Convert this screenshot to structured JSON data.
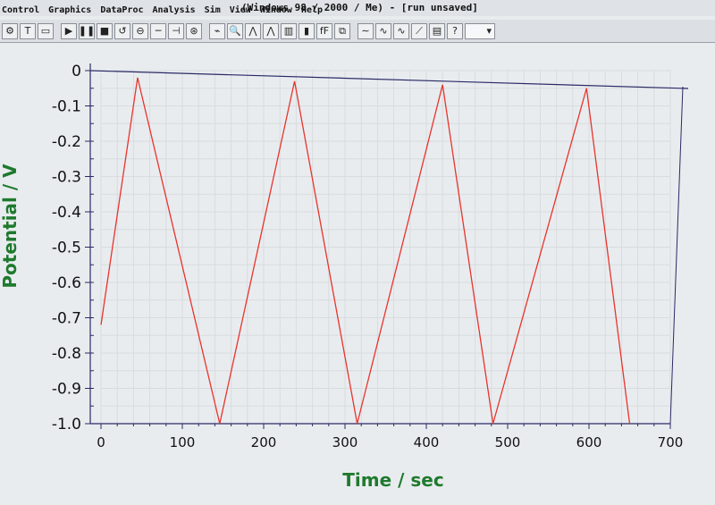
{
  "window": {
    "title": "(Windows 98 / 2000 / Me) - [run unsaved]"
  },
  "menu": [
    "Control",
    "Graphics",
    "DataProc",
    "Analysis",
    "Sim",
    "View",
    "Window",
    "Help"
  ],
  "toolbar": {
    "buttons": [
      {
        "name": "setup-icon",
        "glyph": "⚙"
      },
      {
        "name": "text-icon",
        "glyph": "T"
      },
      {
        "name": "window-icon",
        "glyph": "▭"
      },
      {
        "name": "sep"
      },
      {
        "name": "run-icon",
        "glyph": "▶"
      },
      {
        "name": "pause-icon",
        "glyph": "❚❚"
      },
      {
        "name": "stop-icon",
        "glyph": "■"
      },
      {
        "name": "reverse-icon",
        "glyph": "↺"
      },
      {
        "name": "zero-icon",
        "glyph": "⊖"
      },
      {
        "name": "filter-icon",
        "glyph": "─"
      },
      {
        "name": "cell-icon",
        "glyph": "⊣"
      },
      {
        "name": "rotate-icon",
        "glyph": "⊛"
      },
      {
        "name": "sep"
      },
      {
        "name": "graph-icon",
        "glyph": "⌁"
      },
      {
        "name": "zoom-icon",
        "glyph": "🔍"
      },
      {
        "name": "peak-icon",
        "glyph": "⋀"
      },
      {
        "name": "peak2-icon",
        "glyph": "⋀"
      },
      {
        "name": "color-icon",
        "glyph": "▥"
      },
      {
        "name": "bars-icon",
        "glyph": "▮"
      },
      {
        "name": "font-icon",
        "glyph": "fF"
      },
      {
        "name": "copy-icon",
        "glyph": "⧉"
      },
      {
        "name": "sep"
      },
      {
        "name": "wave1-icon",
        "glyph": "∼"
      },
      {
        "name": "wave2-icon",
        "glyph": "∿"
      },
      {
        "name": "wave3-icon",
        "glyph": "∿"
      },
      {
        "name": "wave4-icon",
        "glyph": "⟋"
      },
      {
        "name": "table-icon",
        "glyph": "▤"
      },
      {
        "name": "help-icon",
        "glyph": "?"
      }
    ],
    "combo_arrow": "▾"
  },
  "chart_data": {
    "type": "line",
    "xlabel": "Time / sec",
    "ylabel": "Potential / V",
    "xlim": [
      0,
      700
    ],
    "ylim": [
      -1.0,
      0
    ],
    "xticks": [
      "0",
      "100",
      "200",
      "300",
      "400",
      "500",
      "600",
      "700"
    ],
    "yticks": [
      "0",
      "-0.1",
      "-0.2",
      "-0.3",
      "-0.4",
      "-0.5",
      "-0.6",
      "-0.7",
      "-0.8",
      "-0.9",
      "-1.0"
    ],
    "series": [
      {
        "color": "#e8342c",
        "x": [
          0,
          45,
          146,
          238,
          315,
          420,
          482,
          597,
          650
        ],
        "y": [
          -0.72,
          -0.02,
          -1.0,
          -0.03,
          -1.0,
          -0.04,
          -1.0,
          -0.05,
          -1.0
        ]
      }
    ],
    "colors": {
      "axes": "#2a2a66",
      "grid": "#d8dcdf",
      "labels": "#1f7a2e",
      "ticks": "#111111"
    }
  }
}
